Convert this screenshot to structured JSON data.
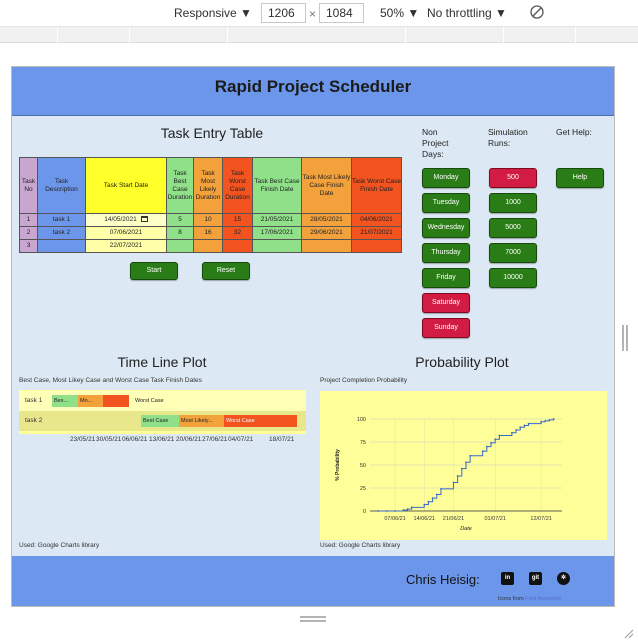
{
  "devtools": {
    "device_mode": "Responsive",
    "width": "1206",
    "times": "×",
    "height": "1084",
    "zoom": "50%",
    "throttling": "No throttling",
    "dropdown_caret": "▼"
  },
  "app": {
    "title": "Rapid Project Scheduler"
  },
  "task_entry": {
    "title": "Task Entry Table",
    "headers": {
      "no": "Task No",
      "desc": "Task Description",
      "start": "Task Start Date",
      "best": "Task Best Case Duration",
      "likely": "Task Most Likely Duration",
      "worst": "Task Worst Case Duration",
      "best_finish": "Task Best Case Finish Date",
      "likely_finish": "Task Most Likely Case Finish Date",
      "worst_finish": "Task Worst Case Finish Date"
    },
    "rows": [
      {
        "no": "1",
        "desc": "task 1",
        "start": "14/05/2021",
        "best": "5",
        "likely": "10",
        "worst": "15",
        "best_finish": "21/05/2021",
        "likely_finish": "28/05/2021",
        "worst_finish": "04/06/2021"
      },
      {
        "no": "2",
        "desc": "task 2",
        "start": "07/06/2021",
        "best": "8",
        "likely": "16",
        "worst": "32",
        "best_finish": "17/06/2021",
        "likely_finish": "29/06/2021",
        "worst_finish": "21/07/2021"
      },
      {
        "no": "3",
        "desc": "",
        "start": "22/07/2021",
        "best": "",
        "likely": "",
        "worst": "",
        "best_finish": "",
        "likely_finish": "",
        "worst_finish": ""
      }
    ],
    "start_button": "Start",
    "reset_button": "Reset"
  },
  "non_project_days": {
    "title": "Non Project Days:",
    "days": [
      {
        "label": "Monday",
        "state": "working"
      },
      {
        "label": "Tuesday",
        "state": "working"
      },
      {
        "label": "Wednesday",
        "state": "working"
      },
      {
        "label": "Thursday",
        "state": "working"
      },
      {
        "label": "Friday",
        "state": "working"
      },
      {
        "label": "Saturday",
        "state": "off"
      },
      {
        "label": "Sunday",
        "state": "off"
      }
    ]
  },
  "simulation_runs": {
    "title": "Simulation Runs:",
    "options": [
      {
        "label": "500",
        "selected": true
      },
      {
        "label": "1000",
        "selected": false
      },
      {
        "label": "5000",
        "selected": false
      },
      {
        "label": "7000",
        "selected": false
      },
      {
        "label": "10000",
        "selected": false
      }
    ]
  },
  "help": {
    "title": "Get Help:",
    "button": "Help"
  },
  "timeline": {
    "title": "Time Line Plot",
    "subtitle": "Best Case, Most Likey Case and Worst Case Task Finish Dates",
    "rows": [
      {
        "label": "task 1",
        "best": "Bes...",
        "likely": "Mo...",
        "worst": "Worst Case"
      },
      {
        "label": "task 2",
        "best": "Best Case",
        "likely": "Most Likely...",
        "worst": "Worst Case"
      }
    ],
    "axis_ticks": [
      "23/05/21",
      "30/05/21",
      "06/06/21",
      "13/06/21",
      "20/06/21",
      "27/06/21",
      "04/07/21",
      "18/07/21"
    ],
    "used": "Used: Google Charts library"
  },
  "probability": {
    "title": "Probability Plot",
    "subtitle": "Project Completion Probability",
    "used": "Used: Google Charts library"
  },
  "chart_data": {
    "type": "line",
    "title": "",
    "xlabel": "Date",
    "ylabel": "% Probability",
    "ylim": [
      0,
      100
    ],
    "y_ticks": [
      "0",
      "25",
      "50",
      "75",
      "100"
    ],
    "x_ticks": [
      "07/06/21",
      "14/06/21",
      "21/06/21",
      "01/07/21",
      "12/07/21"
    ],
    "x": [
      "03/06/21",
      "05/06/21",
      "07/06/21",
      "09/06/21",
      "10/06/21",
      "11/06/21",
      "14/06/21",
      "15/06/21",
      "16/06/21",
      "17/06/21",
      "18/06/21",
      "21/06/21",
      "22/06/21",
      "23/06/21",
      "24/06/21",
      "25/06/21",
      "28/06/21",
      "29/06/21",
      "30/06/21",
      "01/07/21",
      "02/07/21",
      "05/07/21",
      "06/07/21",
      "07/07/21",
      "08/07/21",
      "09/07/21",
      "12/07/21",
      "13/07/21",
      "14/07/21",
      "15/07/21"
    ],
    "series": [
      {
        "values": [
          0,
          0,
          0,
          1,
          2,
          4,
          7,
          10,
          14,
          18,
          24,
          31,
          38,
          46,
          53,
          60,
          65,
          70,
          74,
          78,
          82,
          85,
          88,
          91,
          93,
          95,
          97,
          98,
          99,
          100
        ]
      }
    ],
    "grid": true,
    "legend": "none"
  },
  "footer": {
    "author": "Chris Heisig:",
    "linkedin": "in",
    "git": "git",
    "codewars": "✲",
    "credits_prefix": "Icons from ",
    "credits_link": "Font Awesome"
  },
  "colors": {
    "header": "#6c96ea",
    "body": "#dce8f3",
    "green_button": "#2a7d16",
    "red_button": "#d31c43",
    "best": "#8fe089",
    "likely": "#f3a13b",
    "worst": "#f2531f",
    "plot_bg": "#ffff9a"
  }
}
